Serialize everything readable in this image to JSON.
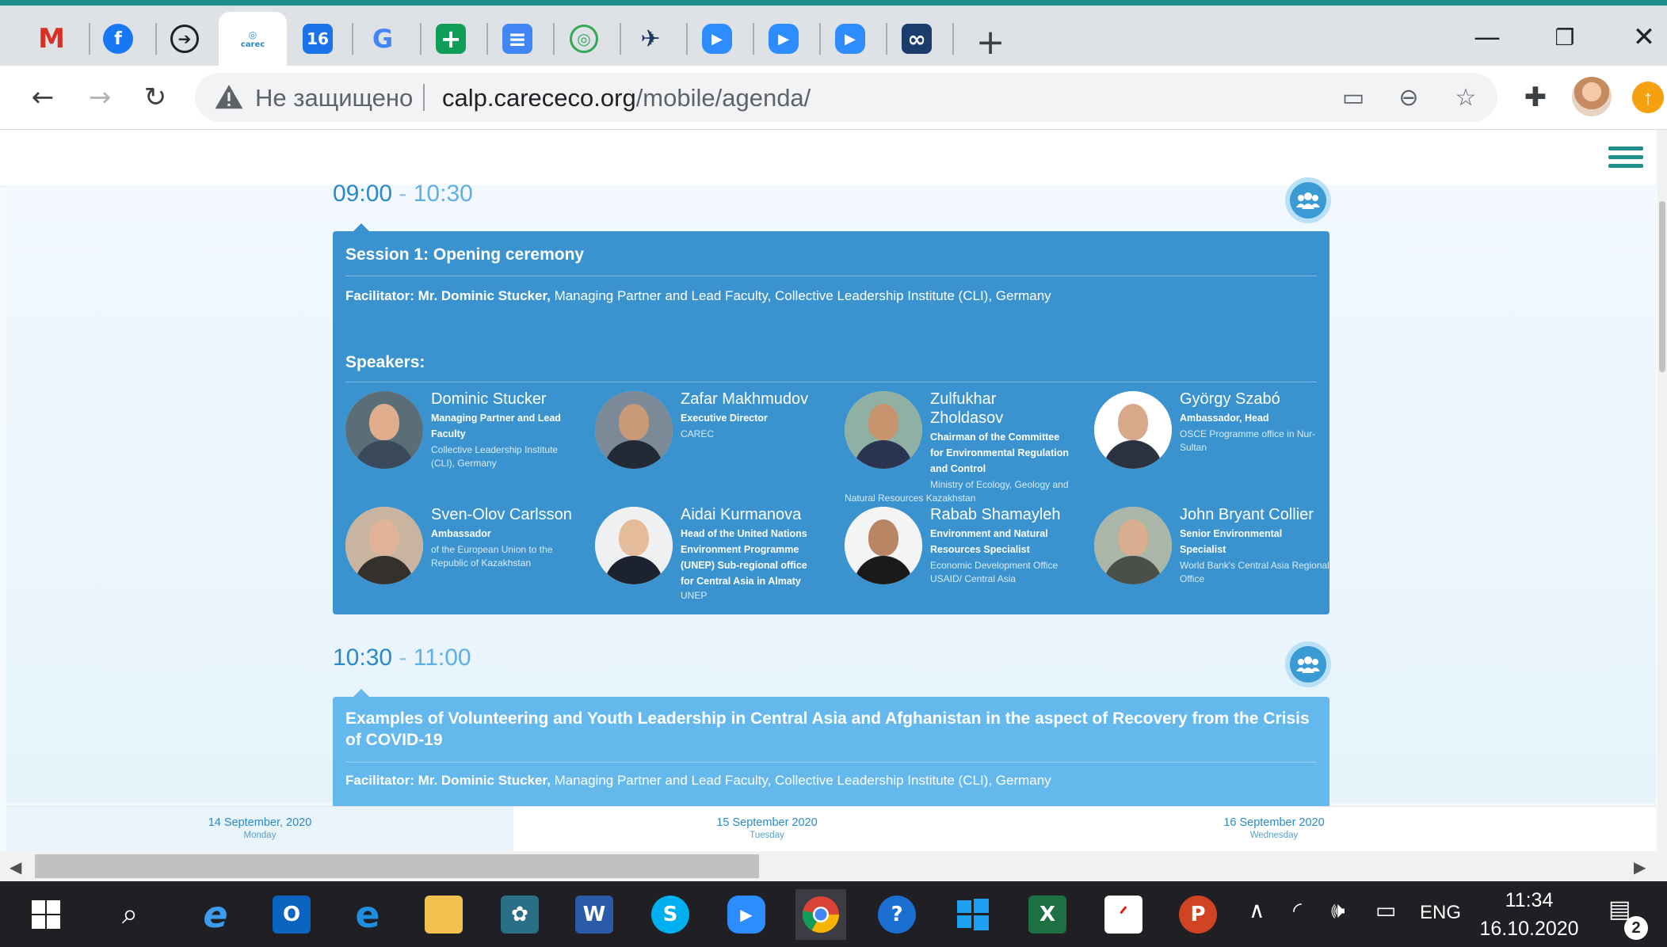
{
  "browser": {
    "tabs": [
      {
        "icon": "gmail-icon",
        "glyph": "M",
        "color": "#d93025"
      },
      {
        "icon": "facebook-icon",
        "glyph": "f",
        "color": "#1877f2"
      },
      {
        "icon": "arrow-circle-icon",
        "glyph": "➔",
        "color": "#202124"
      },
      {
        "icon": "carec-logo-icon",
        "glyph": "carec",
        "color": "#2b8ac6",
        "active": true
      },
      {
        "icon": "calendar-icon",
        "glyph": "16",
        "color": "#1a73e8"
      },
      {
        "icon": "google-icon",
        "glyph": "G",
        "color": "#4285f4"
      },
      {
        "icon": "plus-square-icon",
        "glyph": "+",
        "color": "#0f9d58"
      },
      {
        "icon": "docs-icon",
        "glyph": "≡",
        "color": "#4285f4"
      },
      {
        "icon": "contact-icon",
        "glyph": "◎",
        "color": "#34a853"
      },
      {
        "icon": "bird-icon",
        "glyph": "✈",
        "color": "#1b3a63"
      },
      {
        "icon": "zoom-icon",
        "glyph": "▶",
        "color": "#2d8cff"
      },
      {
        "icon": "zoom-icon",
        "glyph": "▶",
        "color": "#2d8cff"
      },
      {
        "icon": "zoom-icon",
        "glyph": "▶",
        "color": "#2d8cff"
      },
      {
        "icon": "rings-icon",
        "glyph": "∞",
        "color": "#1a3d6d"
      }
    ],
    "new_tab_label": "+",
    "address": {
      "security_label": "Не защищено",
      "domain": "calp.carececo.org",
      "path": "/mobile/agenda/"
    }
  },
  "agenda": {
    "sessions": [
      {
        "time_start": "09:00",
        "time_sep": " - ",
        "time_end": "10:30",
        "title": "Session 1: Opening ceremony",
        "facilitator_label": "Facilitator: Mr. Dominic Stucker,",
        "facilitator_text": " Managing Partner and Lead Faculty, Collective Leadership Institute (CLI), Germany",
        "speakers_heading": "Speakers:",
        "speakers": [
          {
            "name": "Dominic Stucker",
            "role": "Managing Partner and Lead Faculty",
            "org": "Collective Leadership Institute (CLI), Germany"
          },
          {
            "name": "Zafar Makhmudov",
            "role": "Executive Director",
            "org": "CAREC"
          },
          {
            "name": "Zulfukhar Zholdasov",
            "role": "Chairman of the Committee for Environmental Regulation and Control",
            "org": "Ministry of Ecology, Geology and Natural Resources Kazakhstan"
          },
          {
            "name": "György Szabó",
            "role": "Ambassador, Head",
            "org": "OSCE Programme office in Nur-Sultan"
          },
          {
            "name": "Sven-Olov Carlsson",
            "role": "Ambassador",
            "org": "of the European Union to the Republic of Kazakhstan"
          },
          {
            "name": "Aidai Kurmanova",
            "role": "Head of the United Nations Environment Programme (UNEP) Sub-regional office for Central Asia in Almaty",
            "org": "UNEP"
          },
          {
            "name": "Rabab Shamayleh",
            "role": "Environment and Natural Resources Specialist",
            "org": "Economic Development Office USAID/ Central Asia"
          },
          {
            "name": "John Bryant Collier",
            "role": "Senior Environmental Specialist",
            "org": "World Bank's Central Asia Regional Office"
          }
        ]
      },
      {
        "time_start": "10:30",
        "time_sep": " - ",
        "time_end": "11:00",
        "title": "Examples of Volunteering and Youth Leadership in Central Asia and Afghanistan in the aspect of Recovery from the Crisis of COVID-19",
        "facilitator_label": "Facilitator: Mr. Dominic Stucker,",
        "facilitator_text": " Managing Partner and Lead Faculty, Collective Leadership Institute (CLI), Germany"
      }
    ],
    "dates": [
      {
        "date": "14 September, 2020",
        "day": "Monday",
        "active": true
      },
      {
        "date": "15 September 2020",
        "day": "Tuesday"
      },
      {
        "date": "16 September 2020",
        "day": "Wednesday"
      }
    ]
  },
  "taskbar": {
    "language": "ENG",
    "time": "11:34",
    "date": "16.10.2020",
    "notifications": "2"
  }
}
